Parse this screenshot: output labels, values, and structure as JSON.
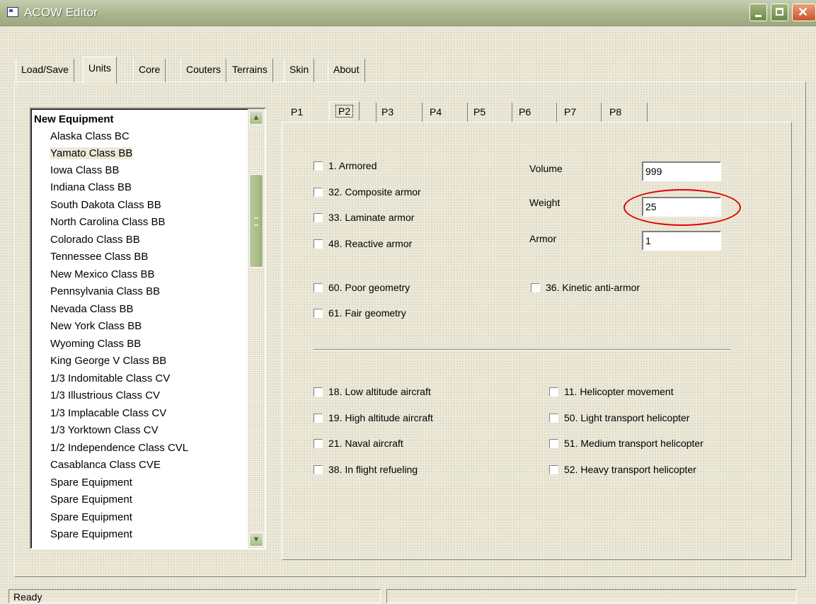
{
  "window": {
    "title": "ACOW Editor"
  },
  "main_tabs": [
    {
      "label": "Load/Save"
    },
    {
      "label": "Units"
    },
    {
      "label": "Core"
    },
    {
      "label": "Couters"
    },
    {
      "label": "Terrains"
    },
    {
      "label": "Skin"
    },
    {
      "label": "About"
    }
  ],
  "active_main_tab": "Units",
  "unit_list": {
    "header": "New Equipment",
    "items": [
      "Alaska Class BC",
      "Yamato Class BB",
      "Iowa Class BB",
      "Indiana Class BB",
      "South Dakota Class BB",
      "North Carolina Class BB",
      "Colorado Class BB",
      "Tennessee Class BB",
      "New Mexico Class BB",
      "Pennsylvania Class BB",
      "Nevada Class BB",
      "New York Class BB",
      "Wyoming Class BB",
      "King George V Class BB",
      "1/3 Indomitable Class CV",
      "1/3 Illustrious Class CV",
      "1/3 Implacable Class CV",
      "1/3 Yorktown Class CV",
      "1/2 Independence Class CVL",
      "Casablanca Class CVE",
      "Spare Equipment",
      "Spare Equipment",
      "Spare Equipment",
      "Spare Equipment"
    ],
    "selected": "Yamato Class BB"
  },
  "sub_tabs": [
    "P1",
    "P2",
    "P3",
    "P4",
    "P5",
    "P6",
    "P7",
    "P8"
  ],
  "active_sub_tab": "P2",
  "armor_flags": [
    {
      "label": "1. Armored",
      "checked": false
    },
    {
      "label": "32. Composite armor",
      "checked": false
    },
    {
      "label": "33. Laminate armor",
      "checked": false
    },
    {
      "label": "48. Reactive armor",
      "checked": false
    },
    {
      "label": "60. Poor geometry",
      "checked": false
    },
    {
      "label": "61. Fair geometry",
      "checked": false
    }
  ],
  "kinetic_flag": {
    "label": "36. Kinetic anti-armor",
    "checked": false
  },
  "fields": {
    "volume": {
      "label": "Volume",
      "value": "999"
    },
    "weight": {
      "label": "Weight",
      "value": "25"
    },
    "armor": {
      "label": "Armor",
      "value": "1"
    }
  },
  "aircraft_flags": [
    {
      "label": "18. Low altitude aircraft",
      "checked": false
    },
    {
      "label": "19. High altitude aircraft",
      "checked": false
    },
    {
      "label": "21. Naval aircraft",
      "checked": false
    },
    {
      "label": "38. In flight refueling",
      "checked": false
    }
  ],
  "helicopter_flags": [
    {
      "label": "11. Helicopter movement",
      "checked": false
    },
    {
      "label": "50. Light transport helicopter",
      "checked": false
    },
    {
      "label": "51. Medium transport helicopter",
      "checked": false
    },
    {
      "label": "52. Heavy transport helicopter",
      "checked": false
    }
  ],
  "status": {
    "text": "Ready"
  },
  "colors": {
    "highlight": "#e00000",
    "title_bar": "#aab48c"
  }
}
